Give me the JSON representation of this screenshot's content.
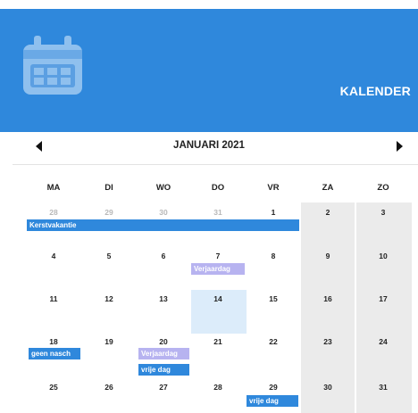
{
  "header": {
    "title": "KALENDER",
    "icon": "calendar-icon",
    "color": "#2f88dc"
  },
  "nav": {
    "month": "JANUARI 2021",
    "prev_icon": "triangle-left-icon",
    "next_icon": "triangle-right-icon"
  },
  "weekdays": [
    "MA",
    "DI",
    "WO",
    "DO",
    "VR",
    "ZA",
    "ZO"
  ],
  "weeks": [
    [
      "28",
      "29",
      "30",
      "31",
      "1",
      "2",
      "3"
    ],
    [
      "4",
      "5",
      "6",
      "7",
      "8",
      "9",
      "10"
    ],
    [
      "11",
      "12",
      "13",
      "14",
      "15",
      "16",
      "17"
    ],
    [
      "18",
      "19",
      "20",
      "21",
      "22",
      "23",
      "24"
    ],
    [
      "25",
      "26",
      "27",
      "28",
      "29",
      "30",
      "31"
    ]
  ],
  "events": {
    "kerstvakantie": "Kerstvakantie",
    "verjaardag_1": "Verjaardag",
    "geen_nasch": "geen nasch",
    "verjaardag_2": "Verjaardag",
    "vrije_dag_1": "vrije dag",
    "vrije_dag_2": "vrije dag"
  },
  "colors": {
    "event_blue": "#2f88dc",
    "event_lilac": "#b7b3f0",
    "today_highlight": "#dcecfa",
    "weekend_bg": "#ebebeb"
  }
}
